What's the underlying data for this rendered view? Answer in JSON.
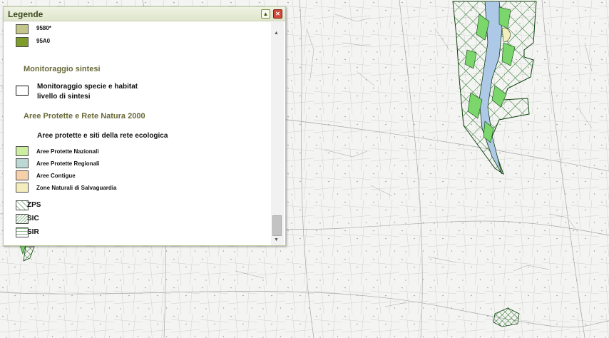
{
  "legend": {
    "title": "Legende",
    "collapse_icon": "chevron-up-icon",
    "close_icon": "close-icon",
    "habitat_items": [
      {
        "code": "9580*",
        "color": "#c3c68a"
      },
      {
        "code": "95A0",
        "color": "#7d9c2a"
      }
    ],
    "monitoring": {
      "title": "Monitoraggio sintesi",
      "item_label_line1": "Monitoraggio specie e habitat",
      "item_label_line2": "livello di sintesi"
    },
    "protected": {
      "title": "Aree Protette e Rete Natura 2000",
      "subtitle": "Aree protette e siti della rete ecologica",
      "items": [
        {
          "label": "Aree Protette Nazionali",
          "color": "#cdeea0"
        },
        {
          "label": "Aree Protette Regionali",
          "color": "#bcd8d2"
        },
        {
          "label": "Aree Contigue",
          "color": "#f6d0a8"
        },
        {
          "label": "Zone Naturali di Salvaguardia",
          "color": "#f4eebc"
        }
      ],
      "network": [
        {
          "label": "ZPS",
          "pattern": "diagonal-hatch"
        },
        {
          "label": "SIC",
          "pattern": "dense-diagonal-hatch"
        },
        {
          "label": "SIR",
          "pattern": "horizontal-hatch"
        }
      ]
    },
    "scroll_position": 0.85
  },
  "map": {
    "hatch_color": "#1a6e1a",
    "green_area_color": "#7bd66b",
    "river_color": "#aec9e8"
  }
}
